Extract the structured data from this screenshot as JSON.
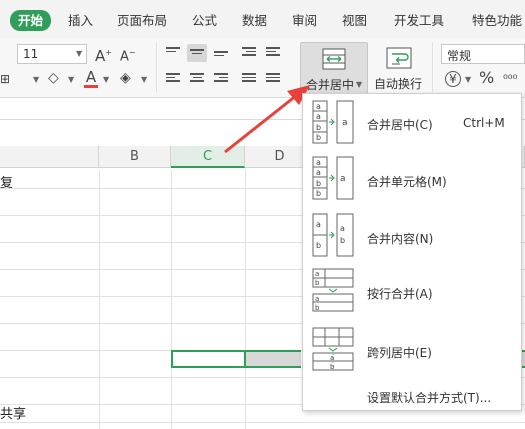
{
  "tabs": [
    {
      "label": "开始",
      "active": true
    },
    {
      "label": "插入"
    },
    {
      "label": "页面布局"
    },
    {
      "label": "公式"
    },
    {
      "label": "数据"
    },
    {
      "label": "审阅"
    },
    {
      "label": "视图"
    },
    {
      "label": "开发工具"
    },
    {
      "label": "特色功能"
    }
  ],
  "ribbon": {
    "font_size": "11",
    "merge_label": "合并居中",
    "wrap_label": "自动换行",
    "number_format": "常规",
    "currency_symbol": "¥",
    "percent_symbol": "%"
  },
  "sheet": {
    "columns": [
      "B",
      "C",
      "D"
    ],
    "selected_column": "C",
    "cell_text_1": "复",
    "cell_text_2": "共享"
  },
  "merge_menu": {
    "items": [
      {
        "label": "合并居中(C)",
        "shortcut": "Ctrl+M"
      },
      {
        "label": "合并单元格(M)"
      },
      {
        "label": "合并内容(N)"
      },
      {
        "label": "按行合并(A)"
      },
      {
        "label": "跨列居中(E)"
      }
    ],
    "set_default": "设置默认合并方式(T)..."
  },
  "colors": {
    "accent": "#2e9e5a",
    "arrow": "#e8413b"
  }
}
